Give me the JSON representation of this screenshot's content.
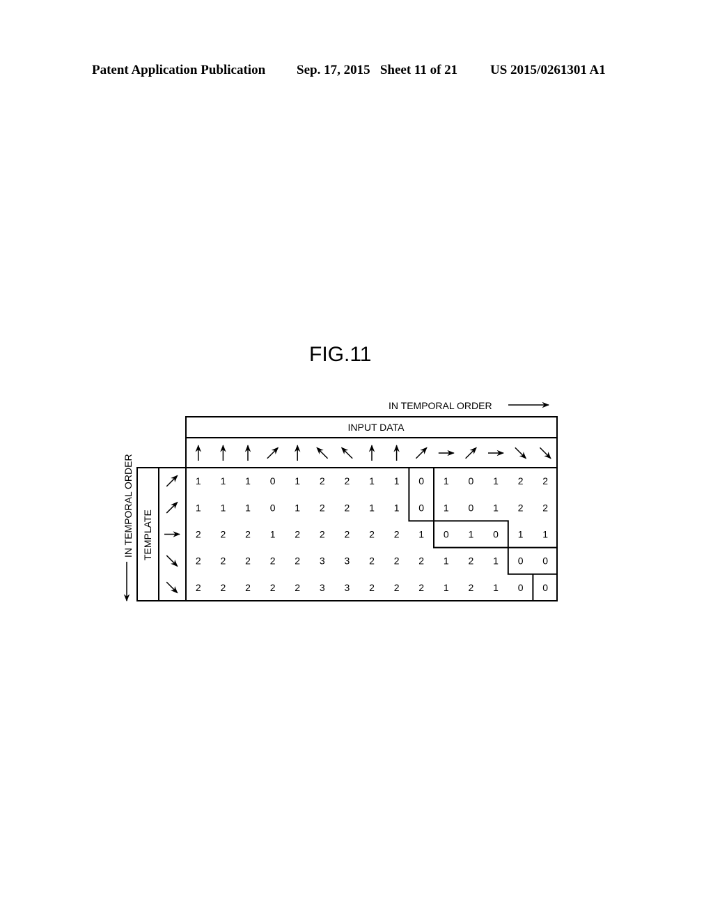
{
  "header": {
    "publication": "Patent Application Publication",
    "date_sheet": "Sep. 17, 2015   Sheet 11 of 21",
    "pub_number": "US 2015/0261301 A1"
  },
  "figure": {
    "title": "FIG.11",
    "top_direction_label": "IN TEMPORAL ORDER",
    "left_direction_label": "IN TEMPORAL ORDER",
    "input_header": "INPUT DATA",
    "template_header": "TEMPLATE",
    "input_arrows": [
      "up",
      "up",
      "up",
      "up-right",
      "up",
      "up-left",
      "up-left",
      "up",
      "up",
      "up-right",
      "right",
      "up-right",
      "right",
      "down-right",
      "down-right"
    ],
    "template_arrows": [
      "up-right",
      "up-right",
      "right",
      "down-right",
      "down-right"
    ],
    "matrix": [
      [
        1,
        1,
        1,
        0,
        1,
        2,
        2,
        1,
        1,
        0,
        1,
        0,
        1,
        2,
        2
      ],
      [
        1,
        1,
        1,
        0,
        1,
        2,
        2,
        1,
        1,
        0,
        1,
        0,
        1,
        2,
        2
      ],
      [
        2,
        2,
        2,
        1,
        2,
        2,
        2,
        2,
        2,
        1,
        0,
        1,
        0,
        1,
        1
      ],
      [
        2,
        2,
        2,
        2,
        2,
        3,
        3,
        2,
        2,
        2,
        1,
        2,
        1,
        0,
        0
      ],
      [
        2,
        2,
        2,
        2,
        2,
        3,
        3,
        2,
        2,
        2,
        1,
        2,
        1,
        0,
        0
      ]
    ],
    "matching_path": [
      [
        0,
        9
      ],
      [
        1,
        9
      ],
      [
        2,
        10
      ],
      [
        2,
        11
      ],
      [
        2,
        12
      ],
      [
        3,
        13
      ],
      [
        3,
        14
      ],
      [
        4,
        14
      ]
    ]
  }
}
